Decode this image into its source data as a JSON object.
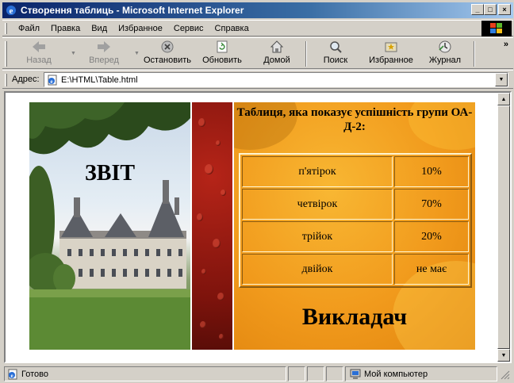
{
  "window": {
    "title": "Створення таблиць - Microsoft Internet Explorer",
    "minimize": "_",
    "maximize": "□",
    "close": "×"
  },
  "menu": {
    "items": [
      "Файл",
      "Правка",
      "Вид",
      "Избранное",
      "Сервис",
      "Справка"
    ]
  },
  "toolbar": {
    "back": "Назад",
    "forward": "Вперед",
    "stop": "Остановить",
    "refresh": "Обновить",
    "home": "Домой",
    "search": "Поиск",
    "favorites": "Избранное",
    "history": "Журнал",
    "more": "»"
  },
  "address": {
    "label": "Адрес:",
    "url": "E:\\HTML\\Table.html"
  },
  "page": {
    "report_title": "ЗВІТ",
    "caption": "Таблиця, яка показує успішність групи ОА-Д-2:",
    "rows": [
      {
        "label": "п'ятірок",
        "value": "10%"
      },
      {
        "label": "четвірок",
        "value": "70%"
      },
      {
        "label": "трійок",
        "value": "20%"
      },
      {
        "label": "двійок",
        "value": "не має"
      }
    ],
    "teacher": "Викладач"
  },
  "status": {
    "text": "Готово",
    "zone": "Мой компьютер"
  },
  "colors": {
    "titlebar_start": "#0a246a",
    "titlebar_end": "#a6caf0",
    "chrome": "#d4d0c8",
    "strip_red": "#7d130c",
    "orange": "#f19a1c"
  }
}
